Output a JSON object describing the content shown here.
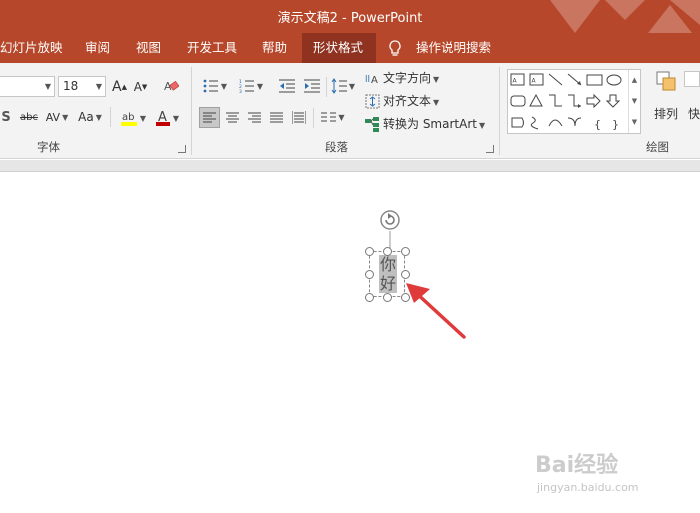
{
  "window": {
    "title": "演示文稿2  -  PowerPoint"
  },
  "tabs": [
    {
      "label": "幻灯片放映",
      "active": false
    },
    {
      "label": "审阅",
      "active": false
    },
    {
      "label": "视图",
      "active": false
    },
    {
      "label": "开发工具",
      "active": false
    },
    {
      "label": "帮助",
      "active": false
    },
    {
      "label": "形状格式",
      "active": true
    }
  ],
  "tell_me": {
    "label": "操作说明搜索",
    "icon": "lightbulb-icon"
  },
  "ribbon": {
    "font_group": {
      "label": "字体",
      "font_size": "18",
      "change_case_label": "Aa",
      "char_spacing_label": "AV",
      "strikethrough_label": "abc",
      "shadow_label": "S",
      "highlight_color": "#ffff00",
      "font_color": "#c00000"
    },
    "paragraph_group": {
      "label": "段落",
      "text_direction_label": "文字方向",
      "align_text_label": "对齐文本",
      "smartart_label": "转换为 SmartArt"
    },
    "drawing_group": {
      "label": "绘图",
      "arrange_label": "排列",
      "quick_styles_label": "快"
    }
  },
  "slide": {
    "textbox_text": "你好"
  },
  "watermark": {
    "brand": "Bai经验",
    "url": "jingyan.baidu.com"
  },
  "colors": {
    "accent": "#b7472a",
    "active_tab": "#8f3320",
    "arrow": "#e03b3b"
  }
}
